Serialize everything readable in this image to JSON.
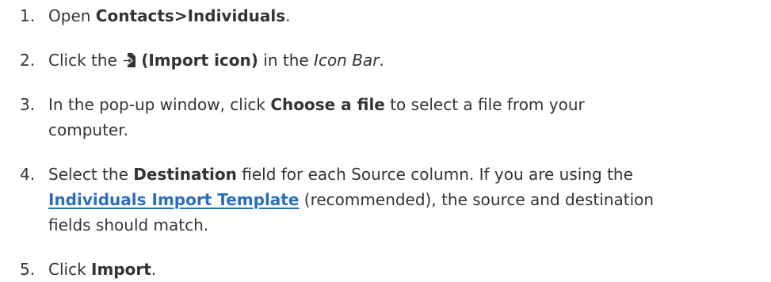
{
  "steps": [
    {
      "number": "1.",
      "parts": {
        "pre": "Open ",
        "bold": "Contacts>Individuals",
        "post": "."
      }
    },
    {
      "number": "2.",
      "parts": {
        "pre": "Click the ",
        "bold": "(Import icon)",
        "mid": " in the ",
        "italic": "Icon Bar",
        "post": "."
      },
      "icon": "import-icon"
    },
    {
      "number": "3.",
      "parts": {
        "pre": "In the pop-up window, click ",
        "bold": "Choose a file",
        "post": " to select a file from your",
        "line2": "computer."
      }
    },
    {
      "number": "4.",
      "parts": {
        "pre": "Select the ",
        "bold": "Destination",
        "post": " field for each Source column. If you are using the",
        "link": "Individuals Import Template",
        "post2": " (recommended), the source and destination",
        "line3": "fields should match."
      }
    },
    {
      "number": "5.",
      "parts": {
        "pre": "Click ",
        "bold": "Import",
        "post": "."
      }
    }
  ],
  "colors": {
    "text": "#333333",
    "link": "#2a6ebd"
  }
}
